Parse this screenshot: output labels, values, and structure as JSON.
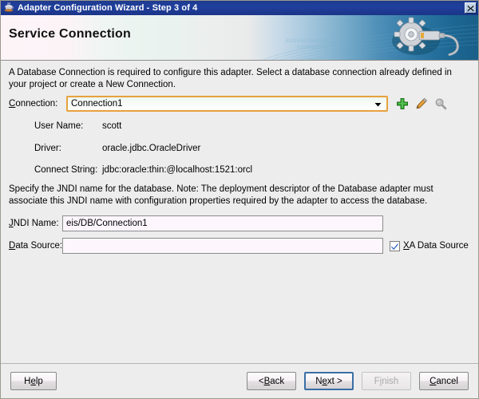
{
  "window": {
    "title": "Adapter Configuration Wizard - Step 3 of 4",
    "title_icon": "java-cup-icon",
    "close_label": "×"
  },
  "banner": {
    "heading": "Service Connection",
    "art_icon": "gear-connector-icon"
  },
  "intro": {
    "text": "A Database Connection is required to configure this adapter. Select a database connection already defined in your project or create a New Connection."
  },
  "connection": {
    "label_prefix": "C",
    "label_rest": "onnection:",
    "value": "Connection1",
    "actions": [
      {
        "name": "add-connection-button",
        "icon": "plus-icon",
        "enabled": true
      },
      {
        "name": "edit-connection-button",
        "icon": "pencil-icon",
        "enabled": true
      },
      {
        "name": "search-connection-button",
        "icon": "magnifier-icon",
        "enabled": false
      }
    ]
  },
  "details": [
    {
      "key": "User Name:",
      "value": "scott"
    },
    {
      "key": "Driver:",
      "value": "oracle.jdbc.OracleDriver"
    },
    {
      "key": "Connect String:",
      "value": "jdbc:oracle:thin:@localhost:1521:orcl"
    }
  ],
  "jndi_note": {
    "text": "Specify the JNDI name for the database.  Note: The deployment descriptor of the Database adapter must associate this JNDI name with configuration properties required by the adapter to access the database."
  },
  "jndi_name": {
    "label_prefix": "J",
    "label_rest": "NDI Name:",
    "value": "eis/DB/Connection1",
    "placeholder": ""
  },
  "data_source": {
    "label_prefix": "D",
    "label_rest": "ata Source:",
    "value": "",
    "placeholder": ""
  },
  "xa_checkbox": {
    "checked": true,
    "label_prefix": "X",
    "label_rest": "A Data Source"
  },
  "buttons": {
    "help": {
      "prefix": "H",
      "mnemonic": "e",
      "rest": "lp"
    },
    "back": {
      "prefix": "< ",
      "mnemonic": "B",
      "rest": "ack"
    },
    "next": {
      "prefix": "N",
      "mnemonic": "e",
      "rest": "xt >"
    },
    "finish": {
      "prefix": "F",
      "mnemonic": "i",
      "rest": "nish"
    },
    "cancel": {
      "prefix": "",
      "mnemonic": "C",
      "rest": "ancel"
    }
  },
  "colors": {
    "titlebar": "#20409e",
    "focus_border": "#e7a23c",
    "next_focus": "#3a6ea5",
    "add_icon": "#34a832",
    "edit_icon": "#e8a33d",
    "check_mark": "#2a5fc0",
    "panel": "#ededed"
  }
}
